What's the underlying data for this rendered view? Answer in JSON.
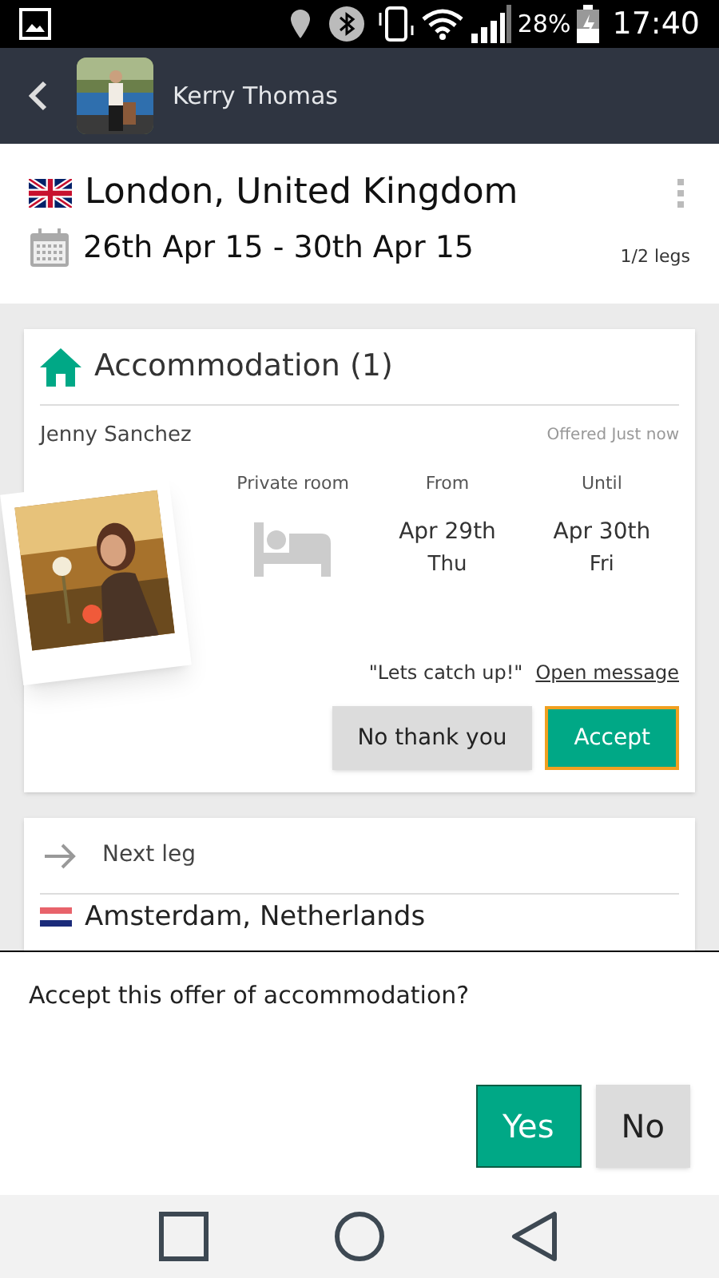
{
  "status_bar": {
    "battery": "28%",
    "time": "17:40"
  },
  "header": {
    "name": "Kerry Thomas"
  },
  "trip": {
    "city": "London, United Kingdom",
    "dates": "26th Apr 15 - 30th Apr 15",
    "legs": "1/2 legs"
  },
  "accommodation": {
    "title": "Accommodation (1)",
    "host": "Jenny Sanchez",
    "offered": "Offered Just now",
    "room_type": "Private room",
    "from": {
      "label": "From",
      "date": "Apr 29th",
      "day": "Thu"
    },
    "until": {
      "label": "Until",
      "date": "Apr 30th",
      "day": "Fri"
    },
    "message": "\"Lets catch up!\"",
    "open_message": "Open message",
    "buttons": [
      {
        "label": "No thank you",
        "kind": "secondary"
      },
      {
        "label": "Accept",
        "kind": "primary"
      }
    ]
  },
  "next_leg": {
    "label": "Next leg",
    "city": "Amsterdam, Netherlands"
  },
  "dialog": {
    "question": "Accept this offer of accommodation?",
    "buttons": [
      {
        "label": "Yes",
        "kind": "primary"
      },
      {
        "label": "No",
        "kind": "secondary"
      }
    ]
  }
}
